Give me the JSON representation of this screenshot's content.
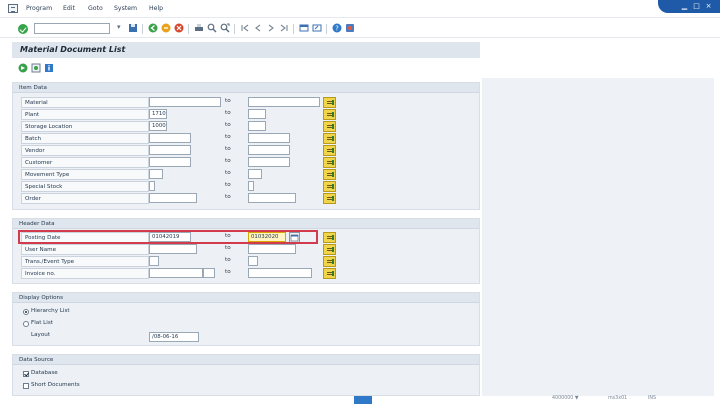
{
  "menubar": {
    "items": [
      "Program",
      "Edit",
      "Goto",
      "System",
      "Help"
    ]
  },
  "toolbar": {
    "icons": [
      "enter-icon",
      "save-icon",
      "back-icon",
      "exit-icon",
      "cancel-icon",
      "print-icon",
      "find-icon",
      "find-next-icon",
      "first-page-icon",
      "prev-page-icon",
      "next-page-icon",
      "last-page-icon",
      "new-session-icon",
      "shortcut-icon",
      "help-icon",
      "customize-icon"
    ]
  },
  "page": {
    "title": "Material Document List"
  },
  "item_data": {
    "title": "Item Data",
    "rows": [
      {
        "label": "Material",
        "from": "",
        "to_label": "to",
        "to": ""
      },
      {
        "label": "Plant",
        "from": "1710",
        "to_label": "to",
        "to": ""
      },
      {
        "label": "Storage Location",
        "from": "1000",
        "to_label": "to",
        "to": ""
      },
      {
        "label": "Batch",
        "from": "",
        "to_label": "to",
        "to": ""
      },
      {
        "label": "Vendor",
        "from": "",
        "to_label": "to",
        "to": ""
      },
      {
        "label": "Customer",
        "from": "",
        "to_label": "to",
        "to": ""
      },
      {
        "label": "Movement Type",
        "from": "",
        "to_label": "to",
        "to": ""
      },
      {
        "label": "Special Stock",
        "from": "",
        "to_label": "to",
        "to": ""
      },
      {
        "label": "Order",
        "from": "",
        "to_label": "to",
        "to": ""
      }
    ]
  },
  "header_data": {
    "title": "Header Data",
    "rows": [
      {
        "label": "Posting Date",
        "from": "01042019",
        "to_label": "to",
        "to": "01032020"
      },
      {
        "label": "User Name",
        "from": "",
        "to_label": "to",
        "to": ""
      },
      {
        "label": "Trans./Event Type",
        "from": "",
        "to_label": "to",
        "to": ""
      },
      {
        "label": "Invoice no.",
        "from": "",
        "to_label": "to",
        "to": ""
      }
    ]
  },
  "display_options": {
    "title": "Display Options",
    "hierarchy": "Hierarchy List",
    "flat": "Flat List",
    "layout_label": "Layout",
    "layout_value": "/08-06-16"
  },
  "data_source": {
    "title": "Data Source",
    "database": "Database",
    "short_docs": "Short Documents"
  },
  "status": {
    "system": "4000000 ▼",
    "server": "ms3x01",
    "mode": "INS"
  },
  "colors": {
    "highlight": "#d23b4b",
    "multiple_selection": "#f0d44a",
    "window_controls": "#1f5aa8"
  }
}
